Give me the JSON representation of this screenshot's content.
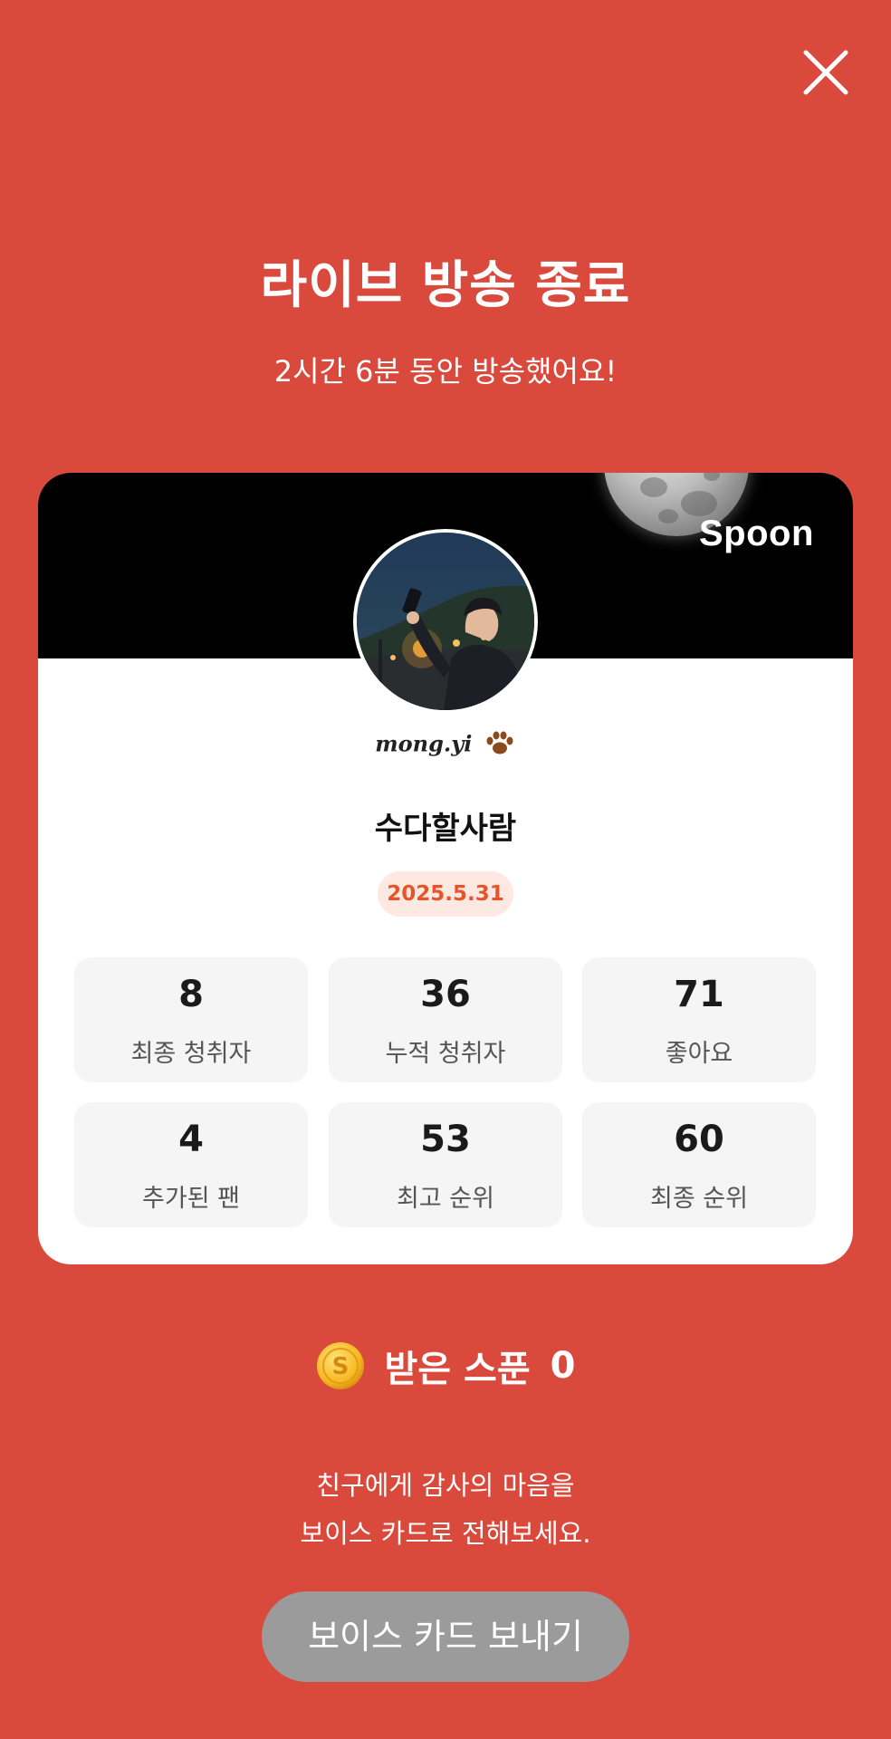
{
  "header": {
    "title": "라이브 방송 종료",
    "subtitle": "2시간 6분 동안 방송했어요!"
  },
  "card": {
    "brand": "Spoon",
    "nickname": "mong.yi",
    "username": "수다할사람",
    "date": "2025.5.31",
    "stats": [
      {
        "value": "8",
        "label": "최종 청취자"
      },
      {
        "value": "36",
        "label": "누적 청취자"
      },
      {
        "value": "71",
        "label": "좋아요"
      },
      {
        "value": "4",
        "label": "추가된 팬"
      },
      {
        "value": "53",
        "label": "최고 순위"
      },
      {
        "value": "60",
        "label": "최종 순위"
      }
    ]
  },
  "spoons": {
    "label": "받은 스푼",
    "count": "0",
    "icon": "spoon-coin-icon"
  },
  "message": {
    "line1": "친구에게 감사의 마음을",
    "line2": "보이스 카드로 전해보세요."
  },
  "actions": {
    "send_voice_card": "보이스 카드 보내기",
    "close_icon": "close-icon"
  },
  "colors": {
    "background": "#D9493C",
    "date_badge_text": "#E8542A",
    "date_badge_bg": "#FDE9E2",
    "button_bg": "#9B9B9B"
  }
}
